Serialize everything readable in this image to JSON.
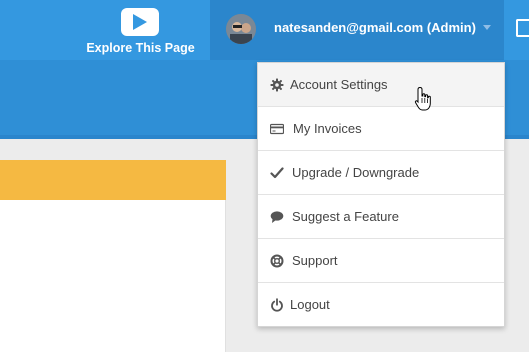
{
  "topbar": {
    "explore_label": "Explore This Page",
    "user_label": "natesanden@gmail.com (Admin)"
  },
  "dropdown": {
    "items": [
      {
        "label": "Account Settings",
        "icon": "gear-icon"
      },
      {
        "label": "My Invoices",
        "icon": "credit-card-icon"
      },
      {
        "label": "Upgrade / Downgrade",
        "icon": "checkmark-icon"
      },
      {
        "label": "Suggest a Feature",
        "icon": "speech-bubble-icon"
      },
      {
        "label": "Support",
        "icon": "lifebuoy-icon"
      },
      {
        "label": "Logout",
        "icon": "power-icon"
      }
    ]
  },
  "colors": {
    "topbar": "#3498e0",
    "user_tab": "#2b86cc",
    "accent_yellow": "#f5b942"
  }
}
